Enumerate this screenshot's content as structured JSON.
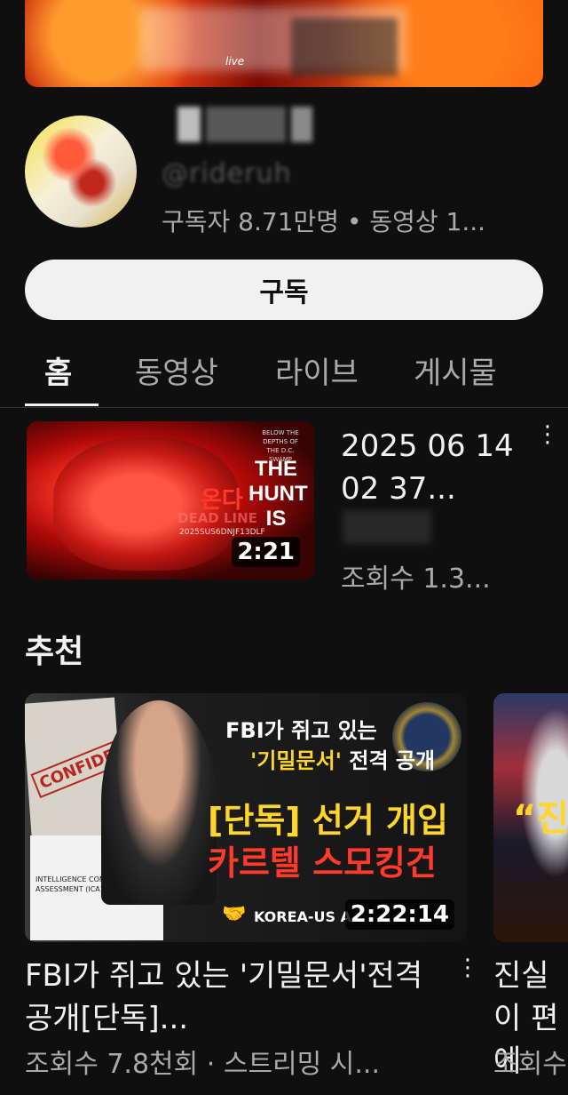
{
  "channel": {
    "banner_text": "live",
    "handle": "@rideruh",
    "stats": "구독자 8.71만명 • 동영상 1...",
    "subscribe_label": "구독"
  },
  "tabs": [
    {
      "label": "홈",
      "active": true
    },
    {
      "label": "동영상",
      "active": false
    },
    {
      "label": "라이브",
      "active": false
    },
    {
      "label": "게시물",
      "active": false
    }
  ],
  "latest_video": {
    "title": "2025 06 14 02 37...",
    "views": "조회수 1.3...",
    "duration": "2:21",
    "thumb_small": "BELOW THE DEPTHS OF THE D.C. SWAMP",
    "thumb_headline": "THE HUNT IS",
    "thumb_korean": "온다",
    "thumb_deadline": "DEAD LINE",
    "thumb_code": "2025SUS6DNJF13DLF"
  },
  "section_title": "추천",
  "recommended": [
    {
      "title": "FBI가 쥐고 있는 '기밀문서'전격 공개[단독]...",
      "meta": "조회수 7.8천회 · 스트리밍 시...",
      "duration": "2:22:14",
      "thumb_line1": "FBI가 쥐고 있는",
      "thumb_line2a": "'기밀문서'",
      "thumb_line2b": " 전격 공개",
      "thumb_line3": "[단독] 선거 개입",
      "thumb_line4": "카르텔 스모킹건",
      "thumb_badge": "KOREA-US A",
      "thumb_stamp": "CONFIDENTIAL",
      "thumb_doc": "INTELLIGENCE COMMUNITY ASSESSMENT (ICA)"
    },
    {
      "title": "진실이 편에",
      "meta": "조회수",
      "thumb_text": "“진"
    }
  ],
  "menu_icon": "more-vert-icon",
  "colors": {
    "background": "#0f0f0f",
    "text_primary": "#f1f1f1",
    "text_secondary": "#aaaaaa",
    "subscribe_bg": "#f1f1f1"
  }
}
